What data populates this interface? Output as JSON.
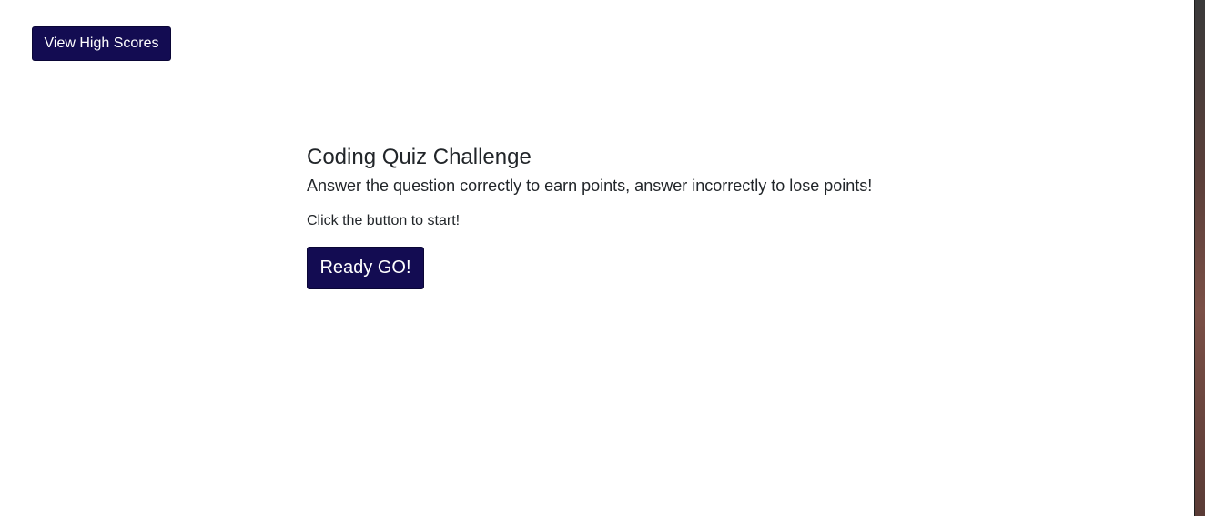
{
  "header": {
    "high_scores_label": "View High Scores"
  },
  "quiz": {
    "title": "Coding Quiz Challenge",
    "subtitle": "Answer the question correctly to earn points, answer incorrectly to lose points!",
    "hint": "Click the button to start!",
    "start_label": "Ready GO!"
  },
  "colors": {
    "button_background": "#130c52",
    "button_text": "#ffffff",
    "page_background": "#ffffff"
  }
}
